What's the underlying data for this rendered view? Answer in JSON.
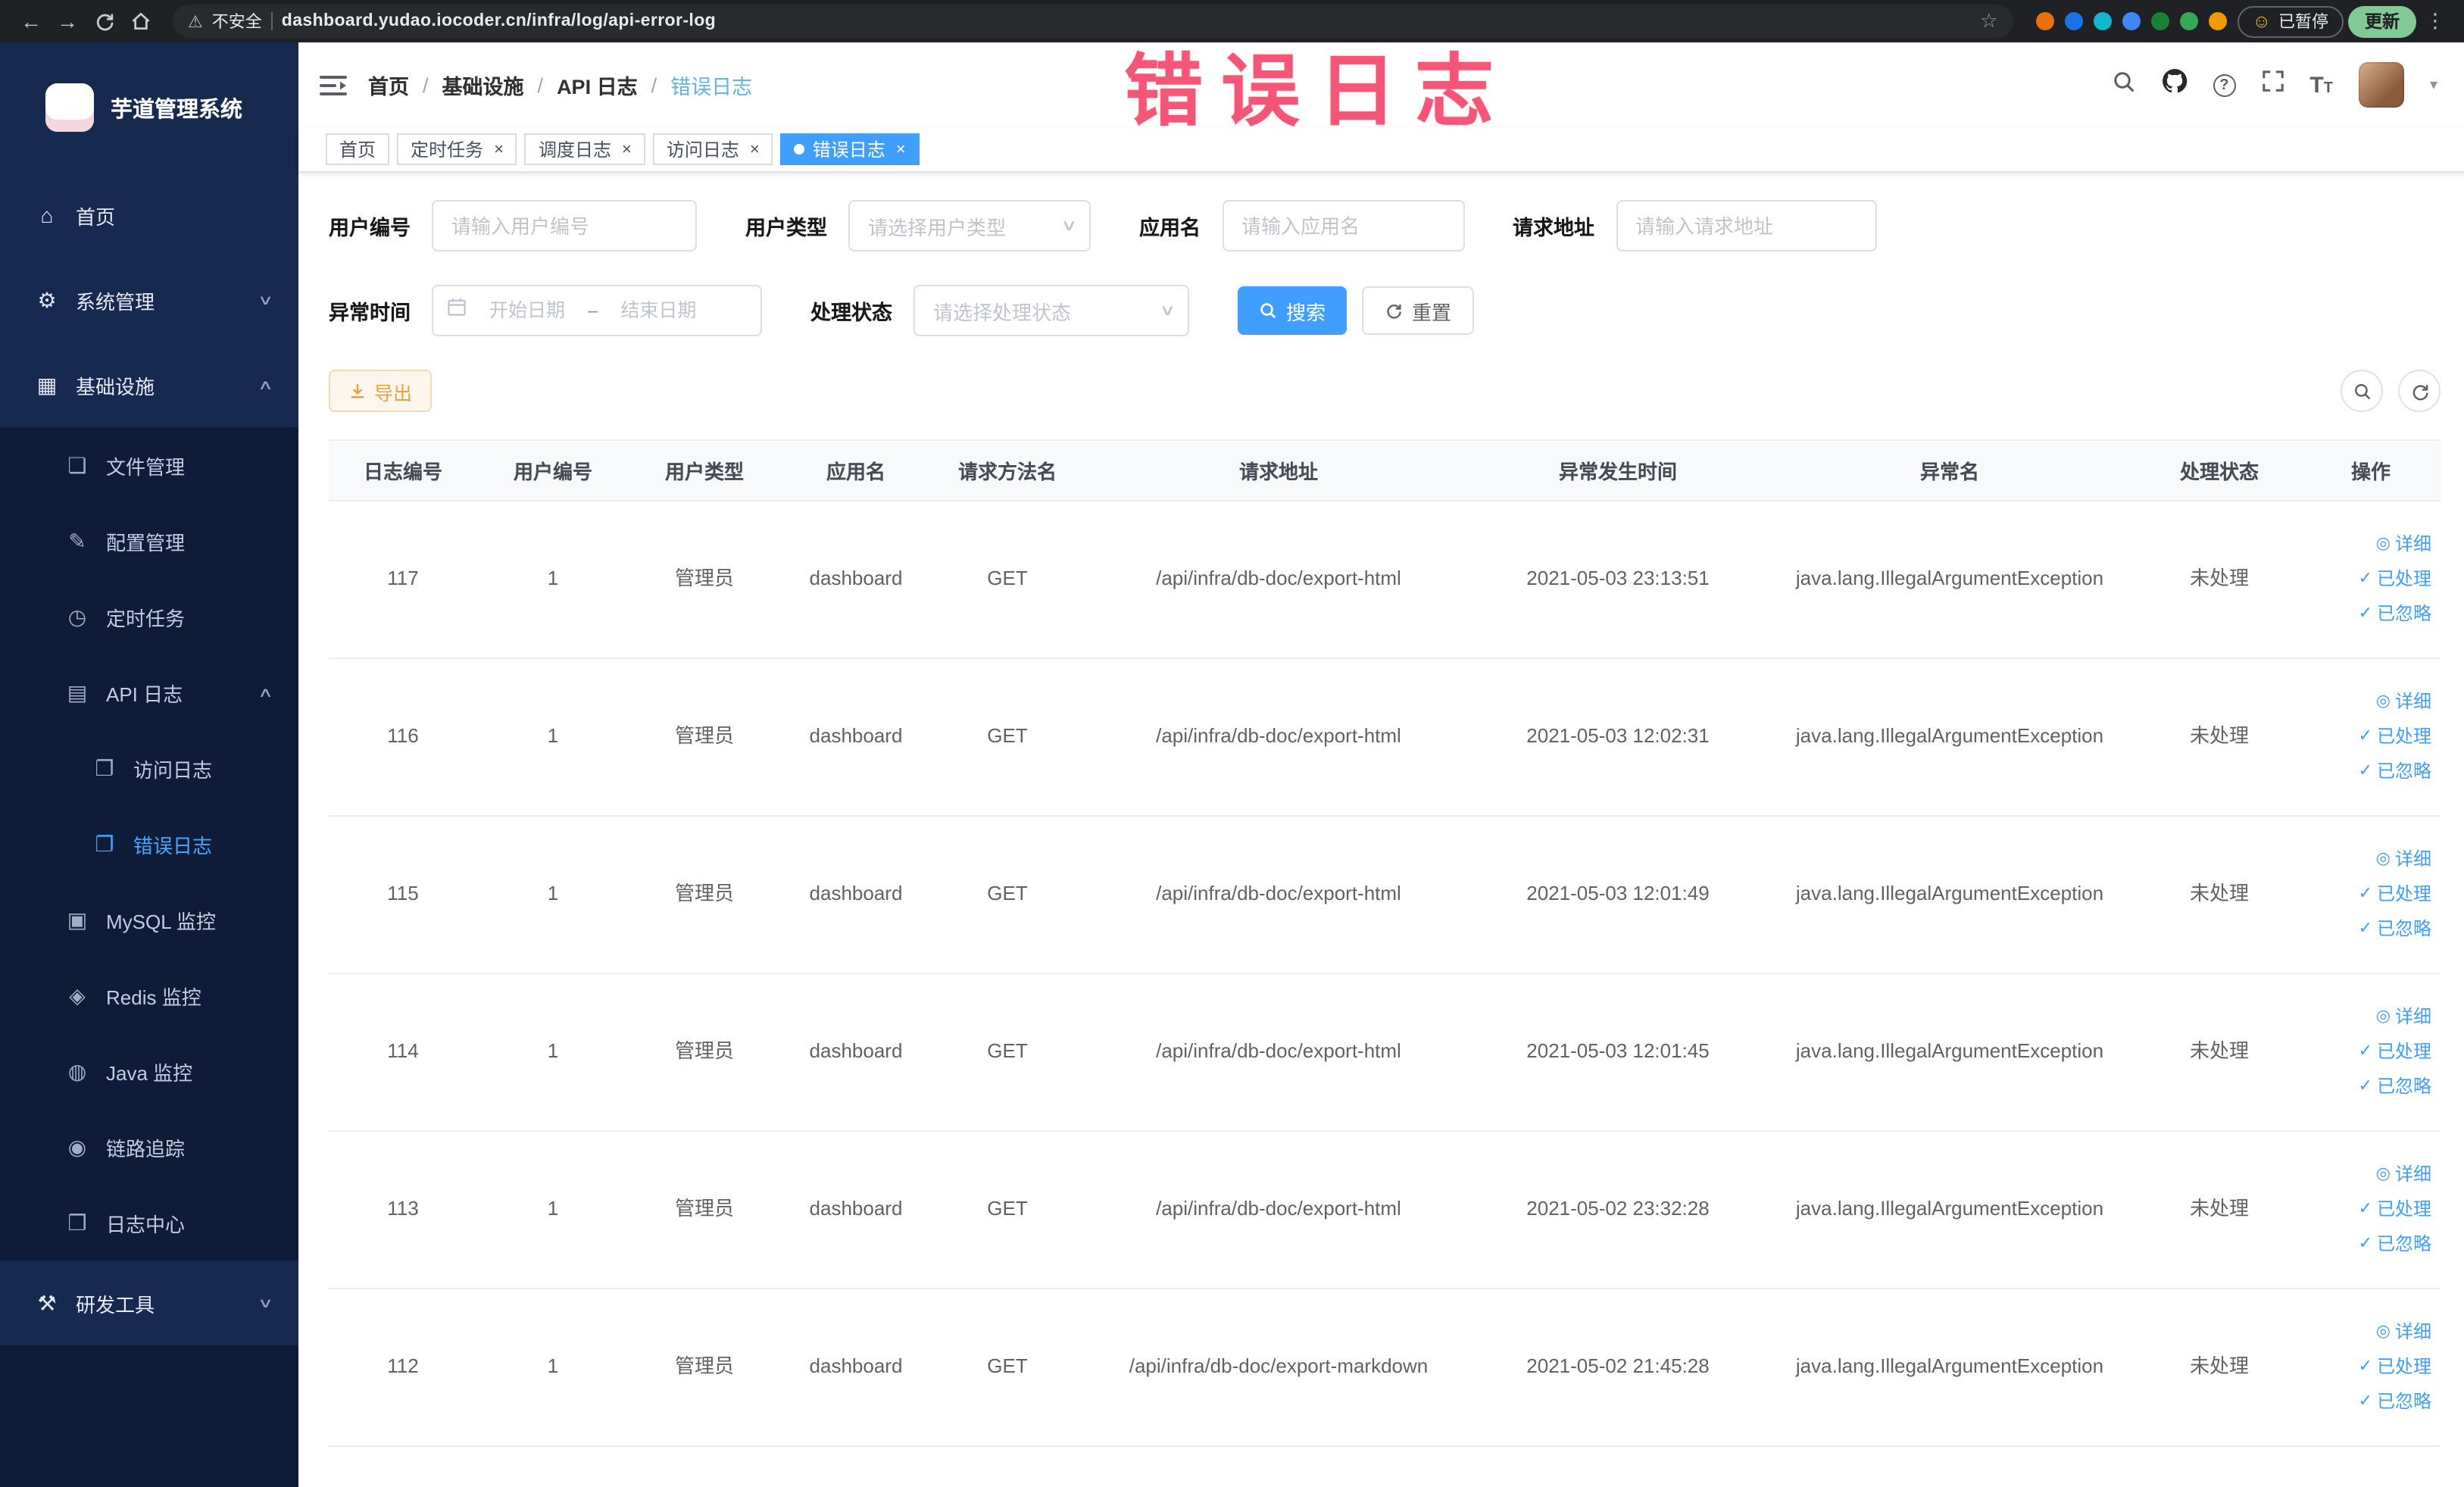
{
  "watermark": "错误日志",
  "browser": {
    "security_label": "不安全",
    "url": "dashboard.yudao.iocoder.cn/infra/log/api-error-log",
    "paused_badge": "已暂停",
    "update_button": "更新",
    "extension_colors": [
      "#e8710a",
      "#1a73e8",
      "#12b5cb",
      "#4285f4",
      "#188038",
      "#34a853",
      "#f29900"
    ]
  },
  "sidebar": {
    "logo_title": "芋道管理系统",
    "items": [
      {
        "label": "首页",
        "icon": "home-icon",
        "level": 0
      },
      {
        "label": "系统管理",
        "icon": "gear-icon",
        "level": 0,
        "arrow": "down"
      },
      {
        "label": "基础设施",
        "icon": "infrastructure-icon",
        "level": 0,
        "arrow": "up"
      },
      {
        "label": "文件管理",
        "icon": "file-manage-icon",
        "level": 1
      },
      {
        "label": "配置管理",
        "icon": "config-icon",
        "level": 1
      },
      {
        "label": "定时任务",
        "icon": "timer-icon",
        "level": 1
      },
      {
        "label": "API 日志",
        "icon": "api-log-icon",
        "level": 1,
        "arrow": "up"
      },
      {
        "label": "访问日志",
        "icon": "access-log-icon",
        "level": 2
      },
      {
        "label": "错误日志",
        "icon": "error-log-icon",
        "level": 2,
        "active": true
      },
      {
        "label": "MySQL 监控",
        "icon": "mysql-icon",
        "level": 1
      },
      {
        "label": "Redis 监控",
        "icon": "redis-icon",
        "level": 1
      },
      {
        "label": "Java 监控",
        "icon": "java-icon",
        "level": 1
      },
      {
        "label": "链路追踪",
        "icon": "trace-icon",
        "level": 1
      },
      {
        "label": "日志中心",
        "icon": "log-center-icon",
        "level": 1
      },
      {
        "label": "研发工具",
        "icon": "devtools-icon",
        "level": 0,
        "arrow": "down"
      }
    ]
  },
  "navbar": {
    "breadcrumb": [
      "首页",
      "基础设施",
      "API 日志",
      "错误日志"
    ]
  },
  "tabs": [
    {
      "label": "首页",
      "closable": false,
      "active": false
    },
    {
      "label": "定时任务",
      "closable": true,
      "active": false
    },
    {
      "label": "调度日志",
      "closable": true,
      "active": false
    },
    {
      "label": "访问日志",
      "closable": true,
      "active": false
    },
    {
      "label": "错误日志",
      "closable": true,
      "active": true
    }
  ],
  "filters": {
    "user_id": {
      "label": "用户编号",
      "placeholder": "请输入用户编号"
    },
    "user_type": {
      "label": "用户类型",
      "placeholder": "请选择用户类型"
    },
    "app_name": {
      "label": "应用名",
      "placeholder": "请输入应用名"
    },
    "request_url": {
      "label": "请求地址",
      "placeholder": "请输入请求地址"
    },
    "exception_time": {
      "label": "异常时间",
      "start_placeholder": "开始日期",
      "separator": "–",
      "end_placeholder": "结束日期"
    },
    "process_status": {
      "label": "处理状态",
      "placeholder": "请选择处理状态"
    },
    "search_button": "搜索",
    "reset_button": "重置"
  },
  "toolbar": {
    "export_button": "导出"
  },
  "table": {
    "columns": [
      "日志编号",
      "用户编号",
      "用户类型",
      "应用名",
      "请求方法名",
      "请求地址",
      "异常发生时间",
      "异常名",
      "处理状态",
      "操作"
    ],
    "action_labels": [
      "详细",
      "已处理",
      "已忽略"
    ],
    "rows": [
      {
        "id": "117",
        "user_id": "1",
        "user_type": "管理员",
        "app": "dashboard",
        "method": "GET",
        "url": "/api/infra/db-doc/export-html",
        "time": "2021-05-03 23:13:51",
        "exception": "java.lang.IllegalArgumentException",
        "status": "未处理"
      },
      {
        "id": "116",
        "user_id": "1",
        "user_type": "管理员",
        "app": "dashboard",
        "method": "GET",
        "url": "/api/infra/db-doc/export-html",
        "time": "2021-05-03 12:02:31",
        "exception": "java.lang.IllegalArgumentException",
        "status": "未处理"
      },
      {
        "id": "115",
        "user_id": "1",
        "user_type": "管理员",
        "app": "dashboard",
        "method": "GET",
        "url": "/api/infra/db-doc/export-html",
        "time": "2021-05-03 12:01:49",
        "exception": "java.lang.IllegalArgumentException",
        "status": "未处理"
      },
      {
        "id": "114",
        "user_id": "1",
        "user_type": "管理员",
        "app": "dashboard",
        "method": "GET",
        "url": "/api/infra/db-doc/export-html",
        "time": "2021-05-03 12:01:45",
        "exception": "java.lang.IllegalArgumentException",
        "status": "未处理"
      },
      {
        "id": "113",
        "user_id": "1",
        "user_type": "管理员",
        "app": "dashboard",
        "method": "GET",
        "url": "/api/infra/db-doc/export-html",
        "time": "2021-05-02 23:32:28",
        "exception": "java.lang.IllegalArgumentException",
        "status": "未处理"
      },
      {
        "id": "112",
        "user_id": "1",
        "user_type": "管理员",
        "app": "dashboard",
        "method": "GET",
        "url": "/api/infra/db-doc/export-markdown",
        "time": "2021-05-02 21:45:28",
        "exception": "java.lang.IllegalArgumentException",
        "status": "未处理"
      }
    ]
  },
  "colors": {
    "primary": "#409eff",
    "warning": "#e6a23c",
    "watermark": "#f54a6e",
    "sidebar_active": "#41a7ff"
  }
}
